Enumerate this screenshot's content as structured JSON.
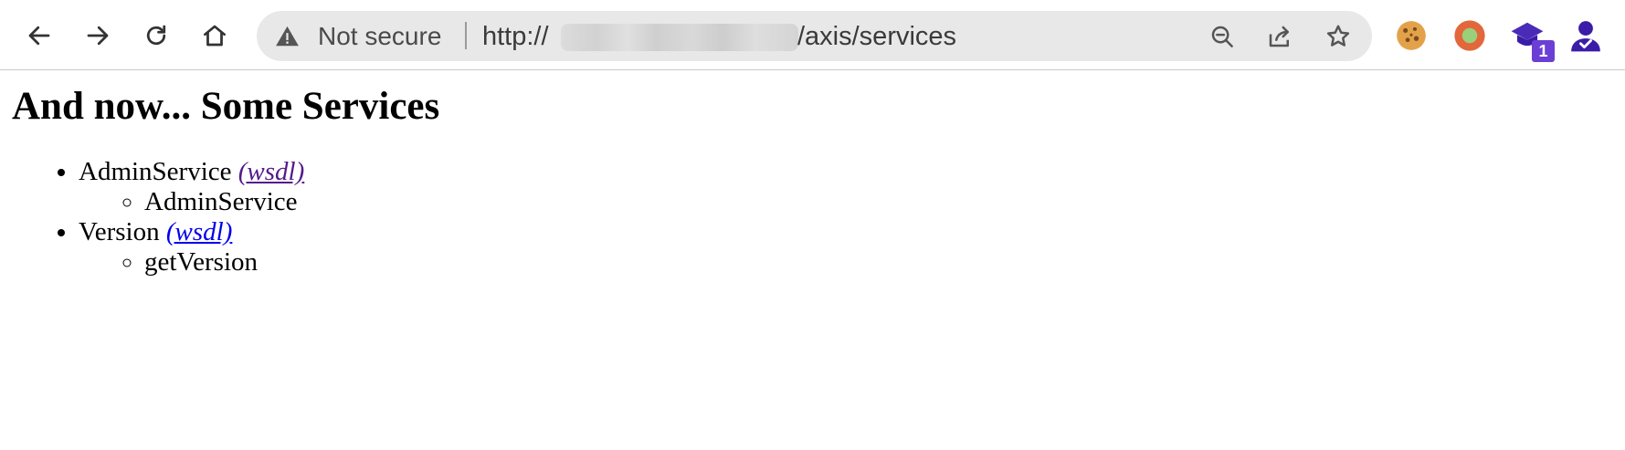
{
  "browser": {
    "security_label": "Not secure",
    "url_scheme": "http://",
    "url_path": "/axis/services",
    "icons": {
      "back": "arrow-left-icon",
      "forward": "arrow-right-icon",
      "reload": "reload-icon",
      "home": "home-icon",
      "warning": "warning-triangle-icon",
      "zoom": "zoom-out-icon",
      "share": "share-icon",
      "bookmark": "star-icon"
    },
    "extensions": [
      {
        "name": "cookie-extension-icon"
      },
      {
        "name": "orange-circle-extension-icon"
      },
      {
        "name": "graduation-cap-extension-icon",
        "badge": "1"
      },
      {
        "name": "profile-avatar-icon"
      }
    ],
    "colors": {
      "omnibox": "#e8e8e8",
      "badge": "#6b3fd6",
      "profile": "#3b1ca8"
    }
  },
  "page": {
    "heading": "And now... Some Services",
    "services": [
      {
        "name": "AdminService",
        "wsdl_label": "(wsdl)",
        "visited": true,
        "operations": [
          "AdminService"
        ]
      },
      {
        "name": "Version",
        "wsdl_label": "(wsdl)",
        "visited": false,
        "operations": [
          "getVersion"
        ]
      }
    ]
  }
}
